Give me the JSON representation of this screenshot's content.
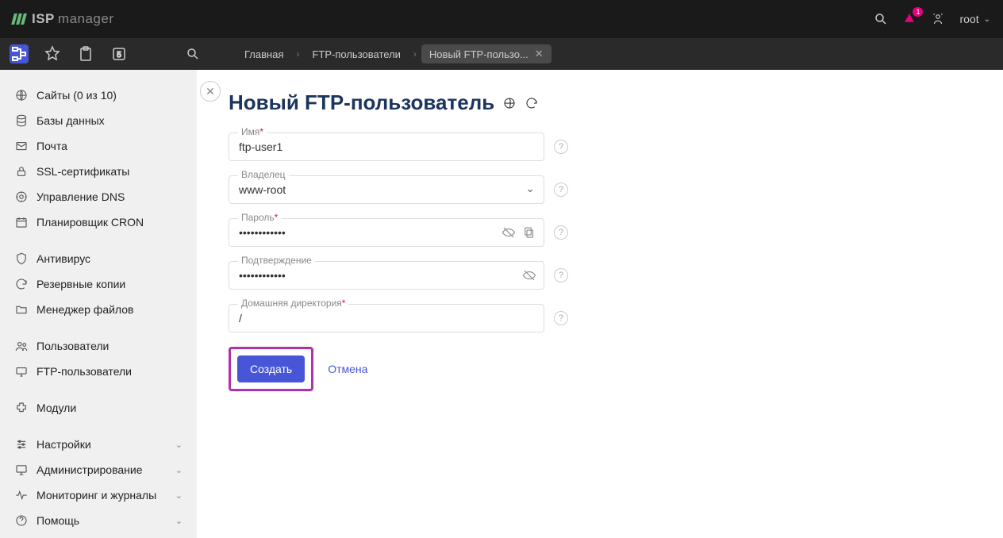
{
  "header": {
    "logo_main": "ISP",
    "logo_light": "manager",
    "user": "root",
    "notification_count": "1"
  },
  "breadcrumb": {
    "home": "Главная",
    "mid": "FTP-пользователи",
    "current": "Новый FTP-пользо..."
  },
  "sidebar": {
    "group1": [
      {
        "label": "Сайты (0 из 10)"
      },
      {
        "label": "Базы данных"
      },
      {
        "label": "Почта"
      },
      {
        "label": "SSL-сертификаты"
      },
      {
        "label": "Управление DNS"
      },
      {
        "label": "Планировщик CRON"
      }
    ],
    "group2": [
      {
        "label": "Антивирус"
      },
      {
        "label": "Резервные копии"
      },
      {
        "label": "Менеджер файлов"
      }
    ],
    "group3": [
      {
        "label": "Пользователи"
      },
      {
        "label": "FTP-пользователи"
      }
    ],
    "group4": [
      {
        "label": "Модули"
      }
    ],
    "group5": [
      {
        "label": "Настройки",
        "expandable": true
      },
      {
        "label": "Администрирование",
        "expandable": true
      },
      {
        "label": "Мониторинг и журналы",
        "expandable": true
      },
      {
        "label": "Помощь",
        "expandable": true
      }
    ]
  },
  "main": {
    "title": "Новый FTP-пользователь",
    "fields": {
      "name_label": "Имя",
      "name_value": "ftp-user1",
      "owner_label": "Владелец",
      "owner_value": "www-root",
      "password_label": "Пароль",
      "password_value": "••••••••••••",
      "confirm_label": "Подтверждение",
      "confirm_value": "••••••••••••",
      "homedir_label": "Домашняя директория",
      "homedir_value": "/"
    },
    "actions": {
      "create": "Создать",
      "cancel": "Отмена"
    }
  }
}
